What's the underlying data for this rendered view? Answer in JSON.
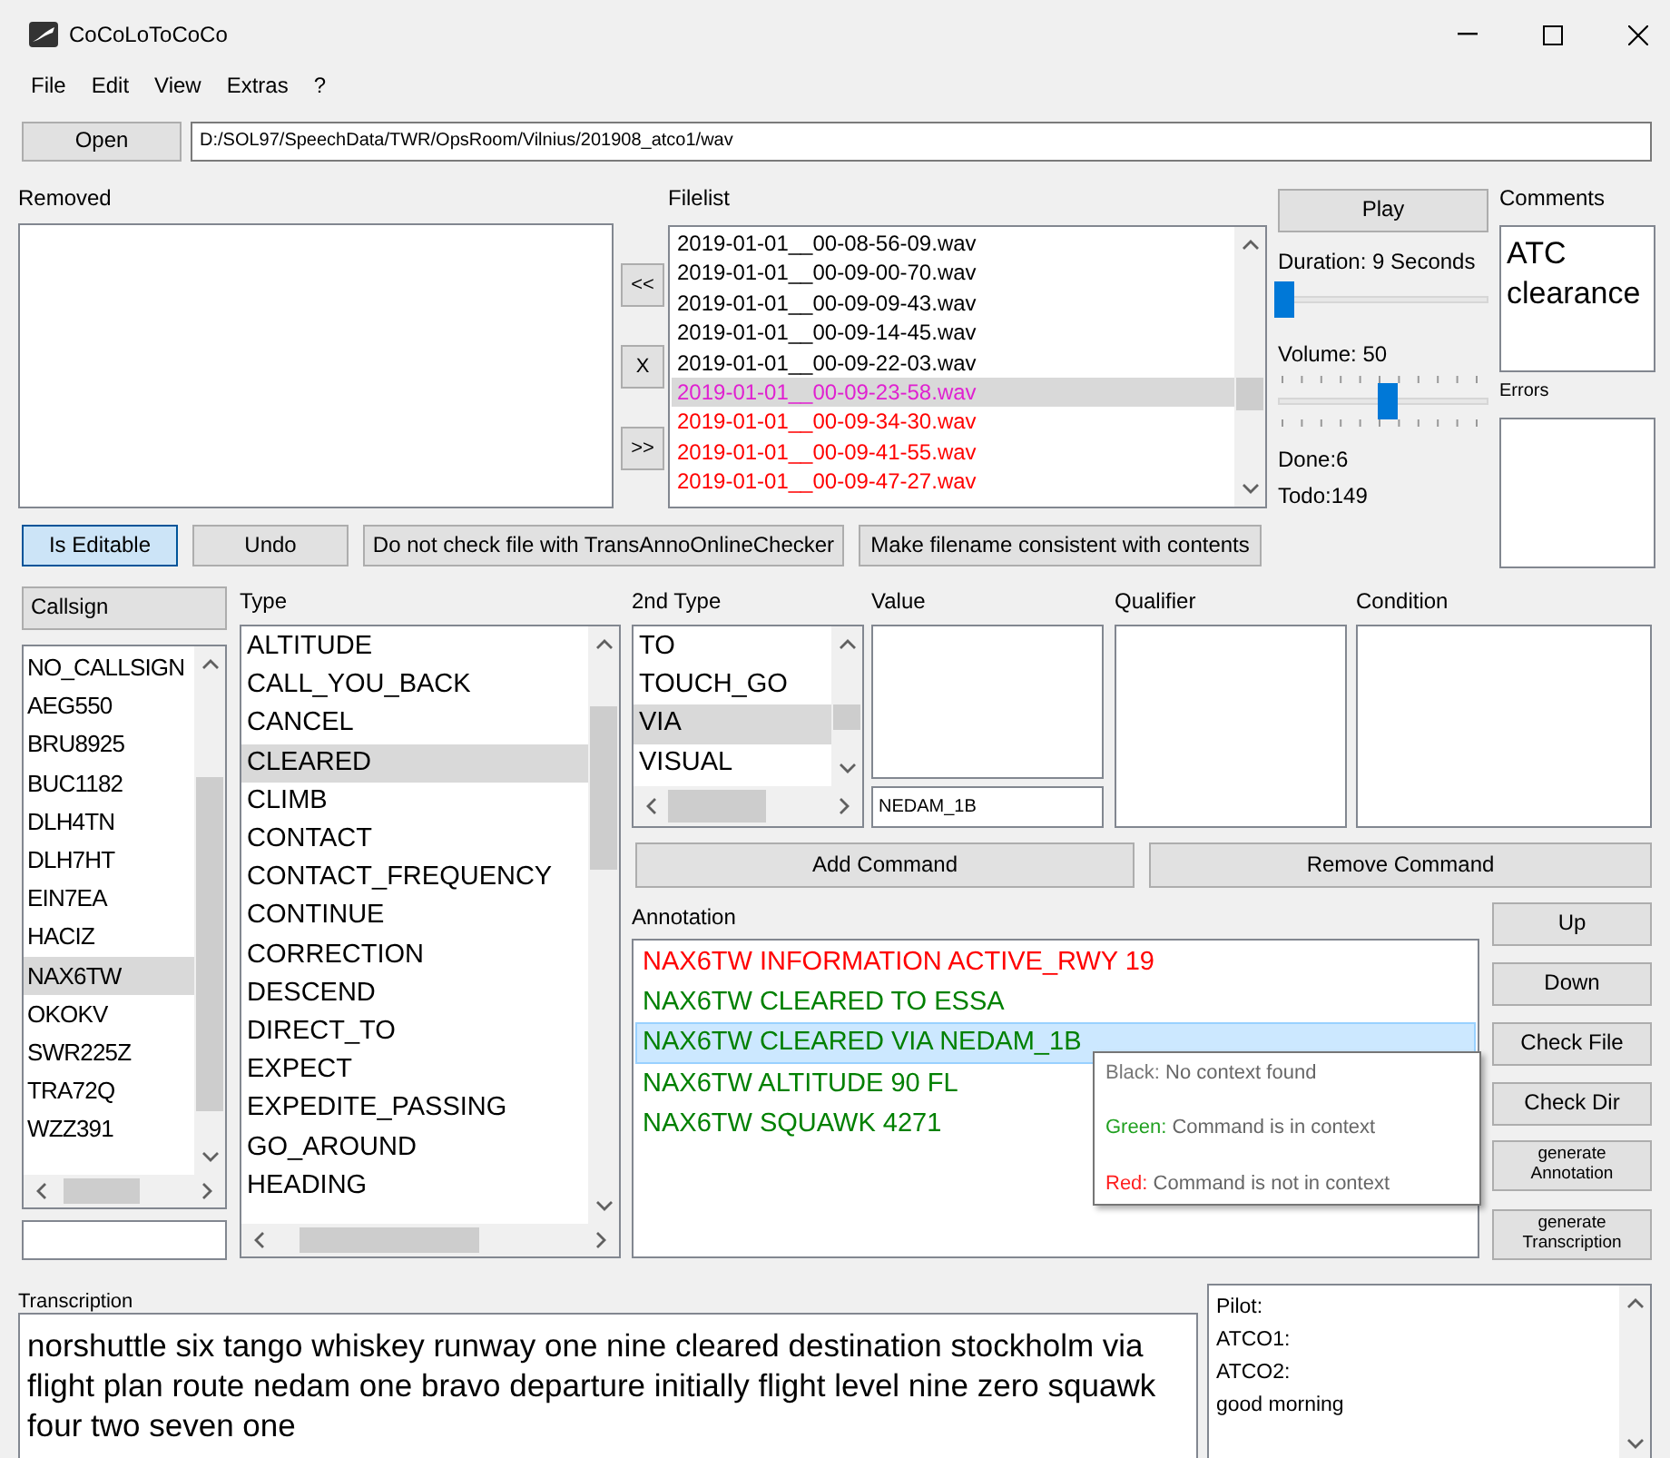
{
  "window": {
    "title": "CoCoLoToCoCo"
  },
  "menu": [
    "File",
    "Edit",
    "View",
    "Extras",
    "?"
  ],
  "open_button": "Open",
  "path": "D:/SOL97/SpeechData/TWR/OpsRoom/Vilnius/201908_atco1/wav",
  "removed": {
    "label": "Removed"
  },
  "move_buttons": [
    "<<",
    "X",
    ">>"
  ],
  "filelist": {
    "label": "Filelist",
    "items": [
      {
        "name": "2019-01-01__00-08-56-09.wav",
        "color": "#000000",
        "selected": false
      },
      {
        "name": "2019-01-01__00-09-00-70.wav",
        "color": "#000000",
        "selected": false
      },
      {
        "name": "2019-01-01__00-09-09-43.wav",
        "color": "#000000",
        "selected": false
      },
      {
        "name": "2019-01-01__00-09-14-45.wav",
        "color": "#000000",
        "selected": false
      },
      {
        "name": "2019-01-01__00-09-22-03.wav",
        "color": "#000000",
        "selected": false
      },
      {
        "name": "2019-01-01__00-09-23-58.wav",
        "color": "#e020d0",
        "selected": true
      },
      {
        "name": "2019-01-01__00-09-34-30.wav",
        "color": "#ff0000",
        "selected": false
      },
      {
        "name": "2019-01-01__00-09-41-55.wav",
        "color": "#ff0000",
        "selected": false
      },
      {
        "name": "2019-01-01__00-09-47-27.wav",
        "color": "#ff0000",
        "selected": false
      }
    ]
  },
  "player": {
    "play": "Play",
    "duration": "Duration: 9 Seconds",
    "duration_slider": {
      "level": 0.03
    },
    "volume": "Volume: 50",
    "volume_slider": {
      "level": 0.52
    },
    "done": "Done:6",
    "todo": "Todo:149"
  },
  "comments": {
    "label": "Comments",
    "text": "ATC clearance"
  },
  "errors": {
    "label": "Errors"
  },
  "action_buttons": [
    {
      "label": "Is Editable",
      "pressed": true
    },
    {
      "label": "Undo",
      "pressed": false
    },
    {
      "label": "Do not check file with TransAnnoOnlineChecker",
      "pressed": false
    },
    {
      "label": "Make filename consistent with contents",
      "pressed": false
    }
  ],
  "callsign": {
    "button": "Callsign",
    "items": [
      {
        "text": "NO_CALLSIGN",
        "selected": false
      },
      {
        "text": "AEG550",
        "selected": false
      },
      {
        "text": "BRU8925",
        "selected": false
      },
      {
        "text": "BUC1182",
        "selected": false
      },
      {
        "text": "DLH4TN",
        "selected": false
      },
      {
        "text": "DLH7HT",
        "selected": false
      },
      {
        "text": "EIN7EA",
        "selected": false
      },
      {
        "text": "HACIZ",
        "selected": false
      },
      {
        "text": "NAX6TW",
        "selected": true
      },
      {
        "text": "OKOKV",
        "selected": false
      },
      {
        "text": "SWR225Z",
        "selected": false
      },
      {
        "text": "TRA72Q",
        "selected": false
      },
      {
        "text": "WZZ391",
        "selected": false
      }
    ]
  },
  "type": {
    "label": "Type",
    "items": [
      {
        "text": "ALTITUDE",
        "selected": false
      },
      {
        "text": "CALL_YOU_BACK",
        "selected": false
      },
      {
        "text": "CANCEL",
        "selected": false
      },
      {
        "text": "CLEARED",
        "selected": true
      },
      {
        "text": "CLIMB",
        "selected": false
      },
      {
        "text": "CONTACT",
        "selected": false
      },
      {
        "text": "CONTACT_FREQUENCY",
        "selected": false
      },
      {
        "text": "CONTINUE",
        "selected": false
      },
      {
        "text": "CORRECTION",
        "selected": false
      },
      {
        "text": "DESCEND",
        "selected": false
      },
      {
        "text": "DIRECT_TO",
        "selected": false
      },
      {
        "text": "EXPECT",
        "selected": false
      },
      {
        "text": "EXPEDITE_PASSING",
        "selected": false
      },
      {
        "text": "GO_AROUND",
        "selected": false
      },
      {
        "text": "HEADING",
        "selected": false
      }
    ]
  },
  "second_type": {
    "label": "2nd Type",
    "items": [
      {
        "text": "TO",
        "selected": false
      },
      {
        "text": "TOUCH_GO",
        "selected": false
      },
      {
        "text": "VIA",
        "selected": true
      },
      {
        "text": "VISUAL",
        "selected": false
      }
    ]
  },
  "value": {
    "label": "Value",
    "field_value": "NEDAM_1B"
  },
  "qualifier": {
    "label": "Qualifier"
  },
  "condition": {
    "label": "Condition"
  },
  "command_buttons": [
    "Add Command",
    "Remove Command"
  ],
  "annotation": {
    "label": "Annotation",
    "items": [
      {
        "text": "NAX6TW INFORMATION ACTIVE_RWY 19",
        "color": "#ff0000",
        "selected": false
      },
      {
        "text": "NAX6TW CLEARED TO ESSA",
        "color": "#008000",
        "selected": false
      },
      {
        "text": "NAX6TW CLEARED VIA NEDAM_1B",
        "color": "#008000",
        "selected": true
      },
      {
        "text": "NAX6TW ALTITUDE 90 FL",
        "color": "#008000",
        "selected": false
      },
      {
        "text": "NAX6TW SQUAWK 4271",
        "color": "#008000",
        "selected": false
      }
    ]
  },
  "tooltip": {
    "lines": [
      {
        "key": "Black:",
        "color": "#777777",
        "text": "No context found"
      },
      {
        "key": "Green:",
        "color": "#20a020",
        "text": "Command is in context"
      },
      {
        "key": "Red:",
        "color": "#ff2020",
        "text": "Command is not in context"
      }
    ]
  },
  "side_buttons": [
    {
      "label": "Up",
      "kind": "normal"
    },
    {
      "label": "Down",
      "kind": "normal"
    },
    {
      "label": "Check File",
      "kind": "normal"
    },
    {
      "label": "Check Dir",
      "kind": "normal"
    },
    {
      "label": "generate Annotation",
      "kind": "small"
    },
    {
      "label": "generate Transcription",
      "kind": "small"
    }
  ],
  "transcription": {
    "label": "Transcription",
    "text": "norshuttle six tango whiskey runway one nine cleared destination stockholm via flight plan route nedam one bravo departure initially flight level nine zero squawk four two seven one"
  },
  "speakers": {
    "lines": [
      "Pilot:",
      "ATCO1:",
      "ATCO2:",
      "good morning"
    ]
  }
}
